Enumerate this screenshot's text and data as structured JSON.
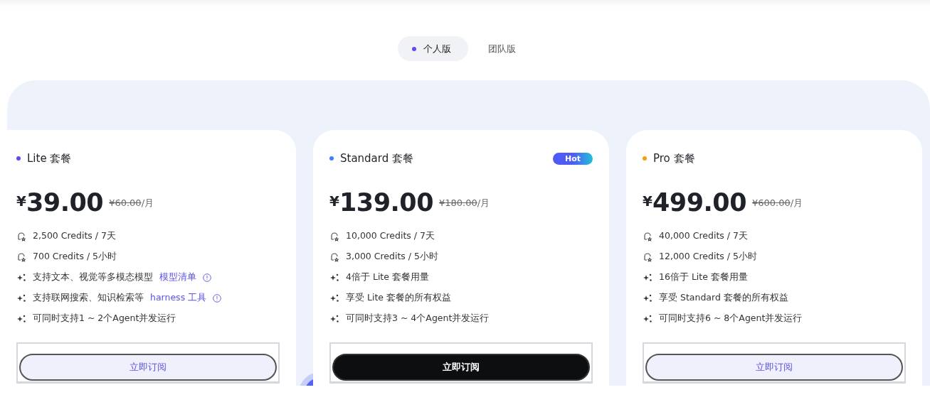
{
  "tabs": [
    {
      "label": "个人版",
      "selected": true
    },
    {
      "label": "团队版",
      "selected": false
    }
  ],
  "plans": [
    {
      "name": "Lite 套餐",
      "color": "#5b4cf0",
      "price": "39.00",
      "currency": "¥",
      "original_price": "¥60.00",
      "period": "/月",
      "features": [
        {
          "kind": "credit",
          "text": "2,500 Credits / 7天"
        },
        {
          "kind": "credit",
          "text": "700 Credits / 5小时"
        },
        {
          "kind": "sparkle",
          "text": "支持文本、视觉等多模态模型",
          "link": "模型清单"
        },
        {
          "kind": "sparkle",
          "text": "支持联网搜索、知识检索等",
          "link": "harness 工具"
        },
        {
          "kind": "sparkle",
          "text": "可同时支持1 ~ 2个Agent并发运行"
        }
      ],
      "button": "立即订阅",
      "primary": false
    },
    {
      "name": "Standard 套餐",
      "color": "#3b82f6",
      "badge": "Hot",
      "price": "139.00",
      "currency": "¥",
      "original_price": "¥180.00",
      "period": "/月",
      "features": [
        {
          "kind": "credit",
          "text": "10,000 Credits / 7天"
        },
        {
          "kind": "credit",
          "text": "3,000 Credits / 5小时"
        },
        {
          "kind": "sparkle",
          "text": "4倍于 Lite 套餐用量"
        },
        {
          "kind": "sparkle",
          "text": "享受 Lite 套餐的所有权益"
        },
        {
          "kind": "sparkle",
          "text": "可同时支持3 ~ 4个Agent并发运行"
        }
      ],
      "button": "立即订阅",
      "primary": true
    },
    {
      "name": "Pro 套餐",
      "color": "#f59e0b",
      "price": "499.00",
      "currency": "¥",
      "original_price": "¥600.00",
      "period": "/月",
      "features": [
        {
          "kind": "credit",
          "text": "40,000 Credits / 7天"
        },
        {
          "kind": "credit",
          "text": "12,000 Credits / 5小时"
        },
        {
          "kind": "sparkle",
          "text": "16倍于 Lite 套餐用量"
        },
        {
          "kind": "sparkle",
          "text": "享受 Standard 套餐的所有权益"
        },
        {
          "kind": "sparkle",
          "text": "可同时支持6 ~ 8个Agent并发运行"
        }
      ],
      "button": "立即订阅",
      "primary": false
    }
  ]
}
